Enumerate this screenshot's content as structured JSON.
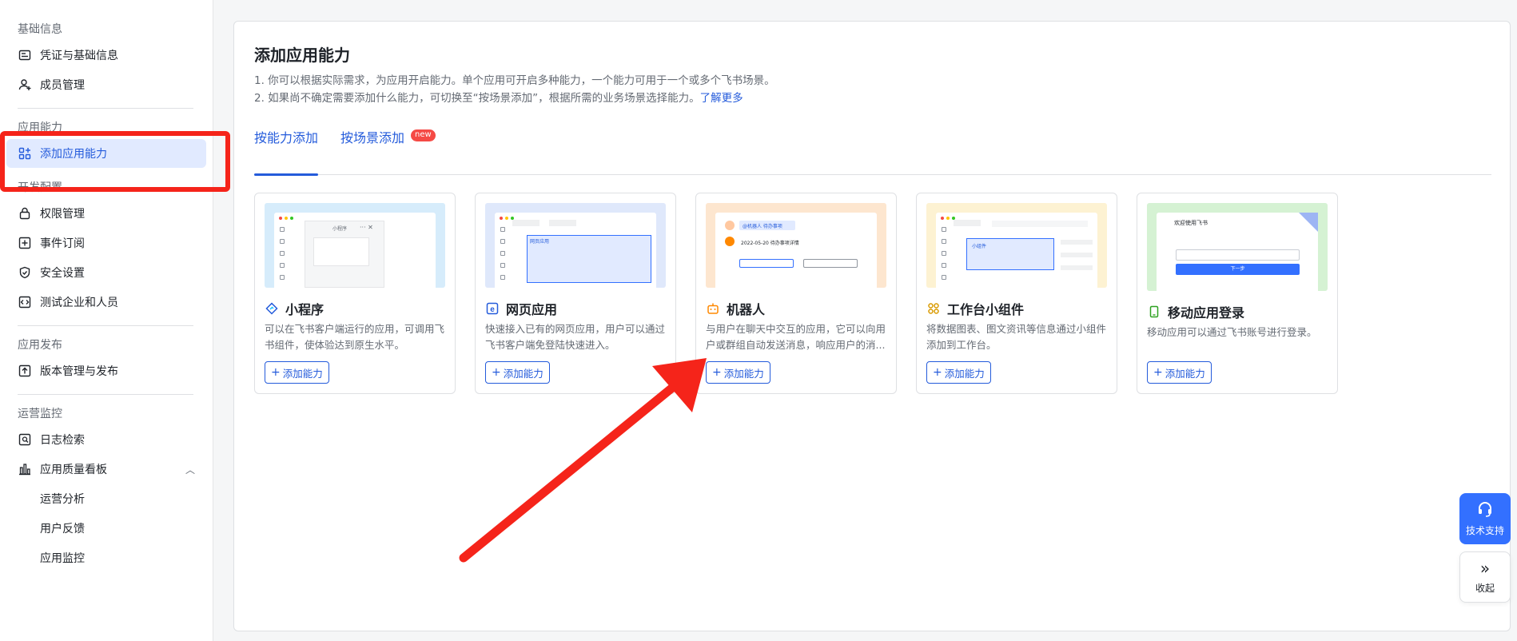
{
  "sidebar": {
    "groups": [
      {
        "title": "基础信息",
        "items": [
          {
            "label": "凭证与基础信息",
            "icon": "credential-icon"
          },
          {
            "label": "成员管理",
            "icon": "member-add-icon"
          }
        ]
      },
      {
        "title": "应用能力",
        "items": [
          {
            "label": "添加应用能力",
            "icon": "apps-add-icon",
            "active": true
          }
        ]
      },
      {
        "title": "开发配置",
        "items": [
          {
            "label": "权限管理",
            "icon": "lock-icon"
          },
          {
            "label": "事件订阅",
            "icon": "event-icon"
          },
          {
            "label": "安全设置",
            "icon": "shield-icon"
          },
          {
            "label": "测试企业和人员",
            "icon": "code-icon"
          }
        ]
      },
      {
        "title": "应用发布",
        "items": [
          {
            "label": "版本管理与发布",
            "icon": "upload-icon"
          }
        ]
      },
      {
        "title": "运营监控",
        "items": [
          {
            "label": "日志检索",
            "icon": "log-search-icon"
          },
          {
            "label": "应用质量看板",
            "icon": "bar-chart-icon"
          }
        ],
        "sub_items": [
          "运营分析",
          "用户反馈",
          "应用监控"
        ]
      }
    ]
  },
  "main": {
    "title": "添加应用能力",
    "desc_line1": "1. 你可以根据实际需求，为应用开启能力。单个应用可开启多种能力，一个能力可用于一个或多个飞书场景。",
    "desc_line2": "2. 如果尚不确定需要添加什么能力，可切换至“按场景添加”，根据所需的业务场景选择能力。",
    "learn_more": "了解更多",
    "tabs": [
      {
        "label": "按能力添加",
        "active": true
      },
      {
        "label": "按场景添加",
        "badge": "new"
      }
    ],
    "add_label": "添加能力",
    "cards": [
      {
        "title": "小程序",
        "desc": "可以在飞书客户端运行的应用，可调用飞书组件，使体验达到原生水平。",
        "thumb_color": "#d6ecfb",
        "thumb_text": "小程序",
        "icon": "mini-program-icon"
      },
      {
        "title": "网页应用",
        "desc": "快速接入已有的网页应用，用户可以通过飞书客户端免登陆快速进入。",
        "thumb_color": "#dfe8fb",
        "thumb_text": "网页应用",
        "icon": "web-app-icon"
      },
      {
        "title": "机器人",
        "desc": "与用户在聊天中交互的应用，它可以向用户或群组自动发送消息，响应用户的消...",
        "thumb_color": "#fde6cf",
        "thumb_text": "@机器人 待办事项",
        "thumb_text2": "2022-05-20 待办事项详情",
        "icon": "robot-icon"
      },
      {
        "title": "工作台小组件",
        "desc": "将数据图表、图文资讯等信息通过小组件添加到工作台。",
        "thumb_color": "#fdf2d2",
        "thumb_text": "小组件",
        "icon": "widget-icon"
      },
      {
        "title": "移动应用登录",
        "desc": "移动应用可以通过飞书账号进行登录。",
        "thumb_color": "#d5f2d3",
        "thumb_text": "欢迎使用飞书",
        "thumb_btn": "下一步",
        "icon": "mobile-login-icon"
      }
    ]
  },
  "floating": {
    "support_label": "技术支持",
    "collapse_label": "收起"
  },
  "colors": {
    "accent": "#245bdb",
    "annotation_red": "#f5241a"
  }
}
